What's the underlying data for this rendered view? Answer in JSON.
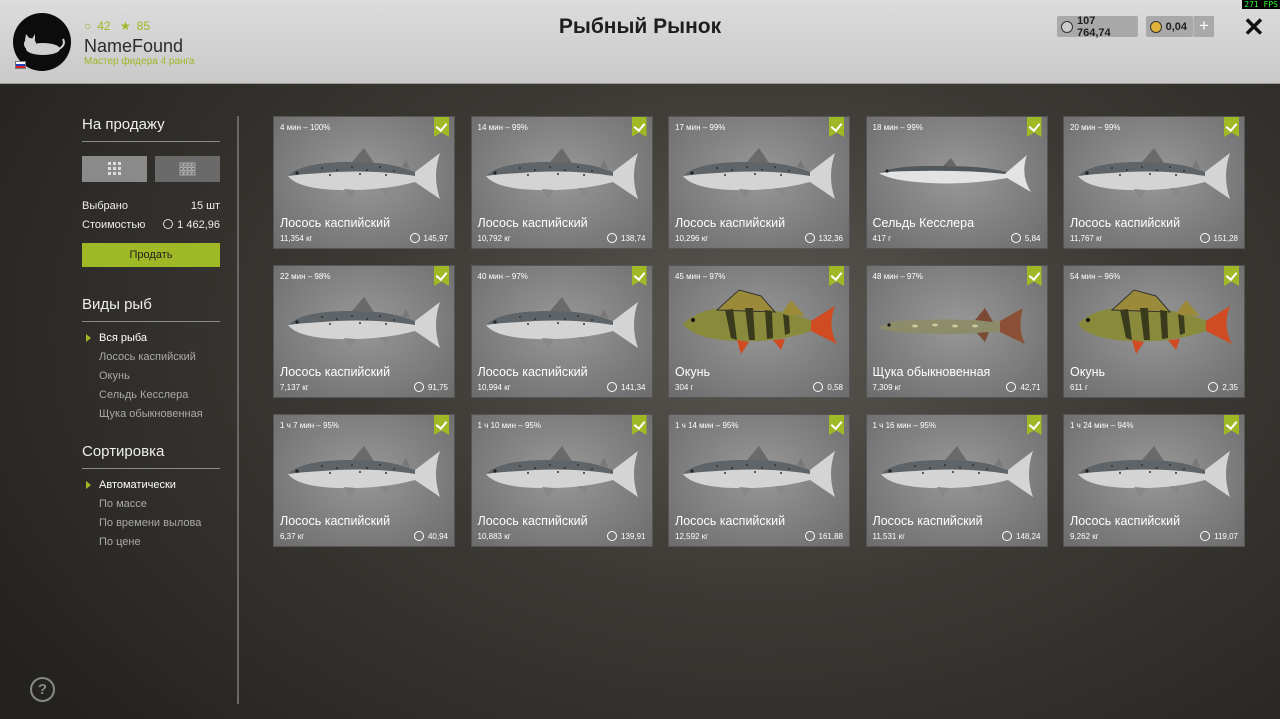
{
  "header": {
    "stat_coins": "42",
    "stat_stars": "85",
    "username": "NameFound",
    "rank": "Мастер фидера 4 ранга",
    "title": "Рыбный Рынок",
    "silver": "107 764,74",
    "gold": "0,04",
    "plus": "+",
    "close": "✕",
    "fps": "271 FPS"
  },
  "sidebar": {
    "for_sale": "На продажу",
    "selected_label": "Выбрано",
    "selected_value": "15 шт",
    "cost_label": "Стоимостью",
    "cost_value": "1 462,96",
    "sell_button": "Продать",
    "species_header": "Виды рыб",
    "species": [
      "Вся рыба",
      "Лосось каспийский",
      "Окунь",
      "Сельдь Кесслера",
      "Щука обыкновенная"
    ],
    "sort_header": "Сортировка",
    "sort": [
      "Автоматически",
      "По массе",
      "По времени вылова",
      "По цене"
    ],
    "help": "?"
  },
  "fish": [
    {
      "time": "4 мин – 100%",
      "name": "Лосось каспийский",
      "weight": "11,354 кг",
      "price": "145,97",
      "kind": "salmon"
    },
    {
      "time": "14 мин – 99%",
      "name": "Лосось каспийский",
      "weight": "10,792 кг",
      "price": "138,74",
      "kind": "salmon"
    },
    {
      "time": "17 мин – 99%",
      "name": "Лосось каспийский",
      "weight": "10,296 кг",
      "price": "132,36",
      "kind": "salmon"
    },
    {
      "time": "18 мин – 99%",
      "name": "Сельдь Кесслера",
      "weight": "417 г",
      "price": "5,84",
      "kind": "herring"
    },
    {
      "time": "20 мин – 99%",
      "name": "Лосось каспийский",
      "weight": "11,767 кг",
      "price": "151,28",
      "kind": "salmon"
    },
    {
      "time": "22 мин – 98%",
      "name": "Лосось каспийский",
      "weight": "7,137 кг",
      "price": "91,75",
      "kind": "salmon"
    },
    {
      "time": "40 мин – 97%",
      "name": "Лосось каспийский",
      "weight": "10,994 кг",
      "price": "141,34",
      "kind": "salmon"
    },
    {
      "time": "45 мин – 97%",
      "name": "Окунь",
      "weight": "304 г",
      "price": "0,58",
      "kind": "perch"
    },
    {
      "time": "48 мин – 97%",
      "name": "Щука обыкновенная",
      "weight": "7,309 кг",
      "price": "42,71",
      "kind": "pike"
    },
    {
      "time": "54 мин – 96%",
      "name": "Окунь",
      "weight": "611 г",
      "price": "2,35",
      "kind": "perch"
    },
    {
      "time": "1 ч 7 мин – 95%",
      "name": "Лосось каспийский",
      "weight": "6,37 кг",
      "price": "40,94",
      "kind": "salmon"
    },
    {
      "time": "1 ч 10 мин – 95%",
      "name": "Лосось каспийский",
      "weight": "10,883 кг",
      "price": "139,91",
      "kind": "salmon"
    },
    {
      "time": "1 ч 14 мин – 95%",
      "name": "Лосось каспийский",
      "weight": "12,592 кг",
      "price": "161,88",
      "kind": "salmon"
    },
    {
      "time": "1 ч 16 мин – 95%",
      "name": "Лосось каспийский",
      "weight": "11,531 кг",
      "price": "148,24",
      "kind": "salmon"
    },
    {
      "time": "1 ч 24 мин – 94%",
      "name": "Лосось каспийский",
      "weight": "9,262 кг",
      "price": "119,07",
      "kind": "salmon"
    }
  ],
  "colors": {
    "accent": "#9fb825",
    "card": "#8a8a8a",
    "topbar": "#d2d2d2"
  }
}
